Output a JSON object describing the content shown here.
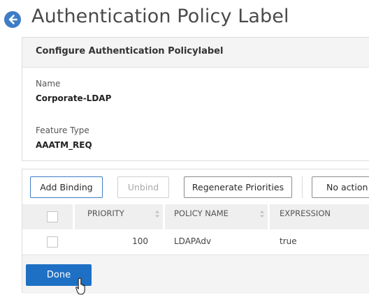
{
  "page": {
    "title": "Authentication Policy Label"
  },
  "config": {
    "header": "Configure Authentication Policylabel",
    "name_label": "Name",
    "name_value": "Corporate-LDAP",
    "feature_label": "Feature Type",
    "feature_value": "AAATM_REQ"
  },
  "toolbar": {
    "add_binding": "Add Binding",
    "unbind": "Unbind",
    "regenerate": "Regenerate Priorities",
    "action_select": "No action"
  },
  "table": {
    "columns": [
      "PRIORITY",
      "POLICY NAME",
      "EXPRESSION"
    ],
    "rows": [
      {
        "priority": "100",
        "policy_name": "LDAPAdv",
        "expression": "true"
      }
    ]
  },
  "footer": {
    "done": "Done"
  },
  "colors": {
    "accent": "#1e70c4",
    "back_icon": "#3e7cc6"
  },
  "icons": [
    "back-arrow-icon",
    "sort-icon",
    "chevron-down-icon",
    "hand-cursor-icon"
  ]
}
